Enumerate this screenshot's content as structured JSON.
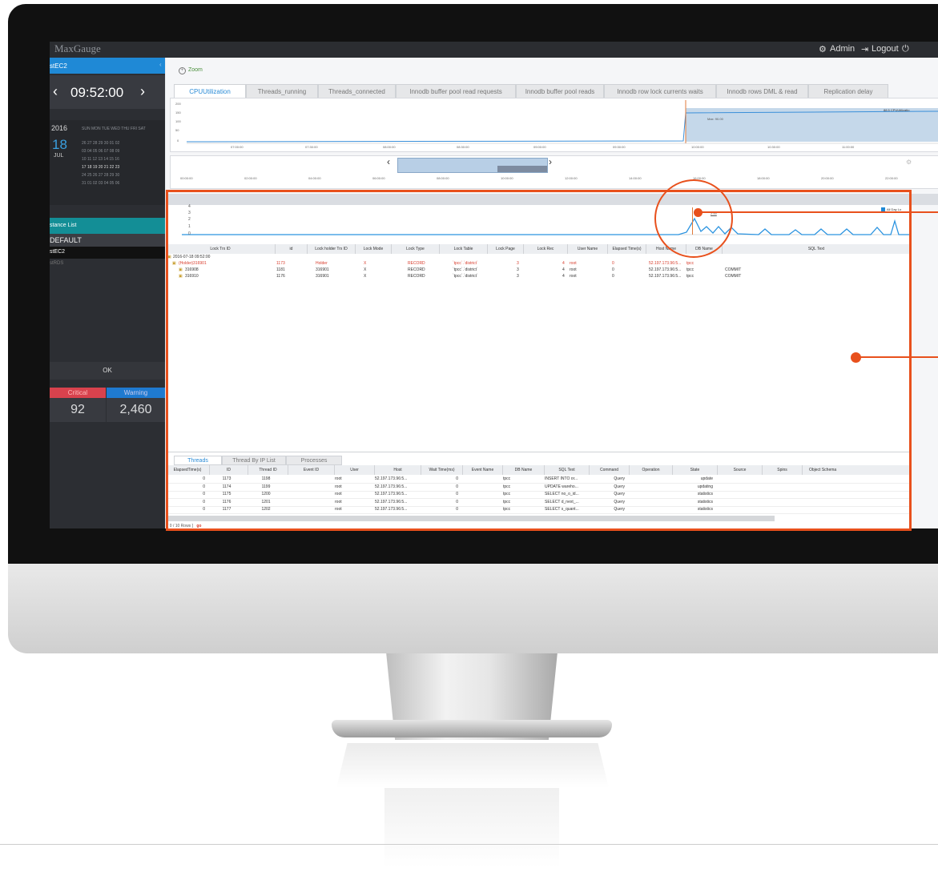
{
  "app": {
    "title": "MaxGauge",
    "admin_label": "Admin",
    "logout_label": "Logout"
  },
  "left": {
    "instance_header": "stEC2",
    "time": "09:52:00",
    "year": "2016",
    "day": "18",
    "month": "JUL",
    "weekdays": "SUN MON TUE WED THU FRI SAT",
    "weeks": [
      "26  27  28  29  30  01  02",
      "03  04  05  06  07  08  09",
      "10  11  12  13  14  15  16",
      "17  18  19  20  21  22  23",
      "24  25  26  27  28  29  30",
      "31  01  02  03  04  05  06"
    ],
    "instance_list_label": "stance List",
    "group": "DEFAULT",
    "instances": [
      "stEC2",
      "stRDS"
    ],
    "ok_label": "OK",
    "critical_label": "Critical",
    "warning_label": "Warning",
    "critical_value": "92",
    "warning_value": "2,460"
  },
  "main": {
    "zoom_label": "Zoom",
    "tabs": [
      "CPUUtilization",
      "Threads_running",
      "Threads_connected",
      "Innodb buffer pool read requests",
      "Innodb buffer pool reads",
      "Innodb row lock currents waits",
      "Innodb rows DML & read",
      "Replication delay"
    ],
    "cpu_chart": {
      "yticks": [
        "200",
        "150",
        "100",
        "50",
        "0"
      ],
      "xticks": [
        "07:00:00",
        "07:30:00",
        "08:00:00",
        "08:30:00",
        "09:00:00",
        "09:30:00",
        "10:00:00",
        "10:30:00",
        "11:00:00"
      ],
      "max_label": "Max: 90.00",
      "legend": "88.5  CPUUtilizatio"
    },
    "nav_chart": {
      "xticks": [
        "00:00:00",
        "02:00:00",
        "04:00:00",
        "06:00:00",
        "08:00:00",
        "10:00:00",
        "12:00:00",
        "14:00:00",
        "16:00:00",
        "18:00:00",
        "20:00:00",
        "22:00:00"
      ]
    },
    "lock_chart": {
      "yticks": [
        "4",
        "3",
        "2",
        "1",
        "0"
      ],
      "legend": "All Day Lo",
      "marker": "2.00"
    },
    "grid": {
      "headers": [
        "Lock Trx ID",
        "id",
        "Lock holder Trx ID",
        "Lock Mode",
        "Lock Type",
        "Lock Table",
        "Lock Page",
        "Lock Rec",
        "User Name",
        "Elapsed Time(s)",
        "Host Name",
        "DB Name",
        "SQL Text"
      ],
      "root": "2016-07-18 09:52:00",
      "rows": [
        [
          "(Holder)316901",
          "1173",
          "Holder",
          "X",
          "RECORD",
          "`tpcc`.`district`",
          "3",
          "4",
          "root",
          "0",
          "52.197.173.96:5...",
          "tpcc",
          ""
        ],
        [
          "316908",
          "1181",
          "316901",
          "X",
          "RECORD",
          "`tpcc`.`district`",
          "3",
          "4",
          "root",
          "0",
          "52.197.173.96:5...",
          "tpcc",
          "COMMIT"
        ],
        [
          "316910",
          "1176",
          "316901",
          "X",
          "RECORD",
          "`tpcc`.`district`",
          "3",
          "4",
          "root",
          "0",
          "52.197.173.96:5...",
          "tpcc",
          "COMMIT"
        ]
      ]
    },
    "bottom_tabs": [
      "Threads",
      "Thread By IP List",
      "Processes"
    ],
    "threads": {
      "headers": [
        "ElapsedTime(s)",
        "ID",
        "Thread ID",
        "Event ID",
        "User",
        "Host",
        "Wait Time(ms)",
        "Event Name",
        "DB Name",
        "SQL Text",
        "Command",
        "Operation",
        "State",
        "Source",
        "Spins",
        "Object Schema"
      ],
      "rows": [
        [
          "0",
          "1173",
          "1198",
          "",
          "root",
          "52.197.173.96:5...",
          "0",
          "",
          "tpcc",
          "INSERT INTO or...",
          "Query",
          "",
          "update",
          "",
          "",
          ""
        ],
        [
          "0",
          "1174",
          "1199",
          "",
          "root",
          "52.197.173.96:5...",
          "0",
          "",
          "tpcc",
          "UPDATE wareho...",
          "Query",
          "",
          "updating",
          "",
          "",
          ""
        ],
        [
          "0",
          "1175",
          "1200",
          "",
          "root",
          "52.197.173.96:5...",
          "0",
          "",
          "tpcc",
          "SELECT no_o_id...",
          "Query",
          "",
          "statistics",
          "",
          "",
          ""
        ],
        [
          "0",
          "1176",
          "1201",
          "",
          "root",
          "52.197.173.96:5...",
          "0",
          "",
          "tpcc",
          "SELECT d_next_...",
          "Query",
          "",
          "statistics",
          "",
          "",
          ""
        ],
        [
          "0",
          "1177",
          "1202",
          "",
          "root",
          "52.197.173.96:5...",
          "0",
          "",
          "tpcc",
          "SELECT s_quant...",
          "Query",
          "",
          "statistics",
          "",
          "",
          ""
        ]
      ],
      "rows_label": "[ 0 / 10 Rows ]",
      "go_label": "go"
    }
  },
  "colors": {
    "accent": "#e8501c",
    "blue": "#1f89d6",
    "teal": "#138e96",
    "critical": "#d8424d"
  }
}
